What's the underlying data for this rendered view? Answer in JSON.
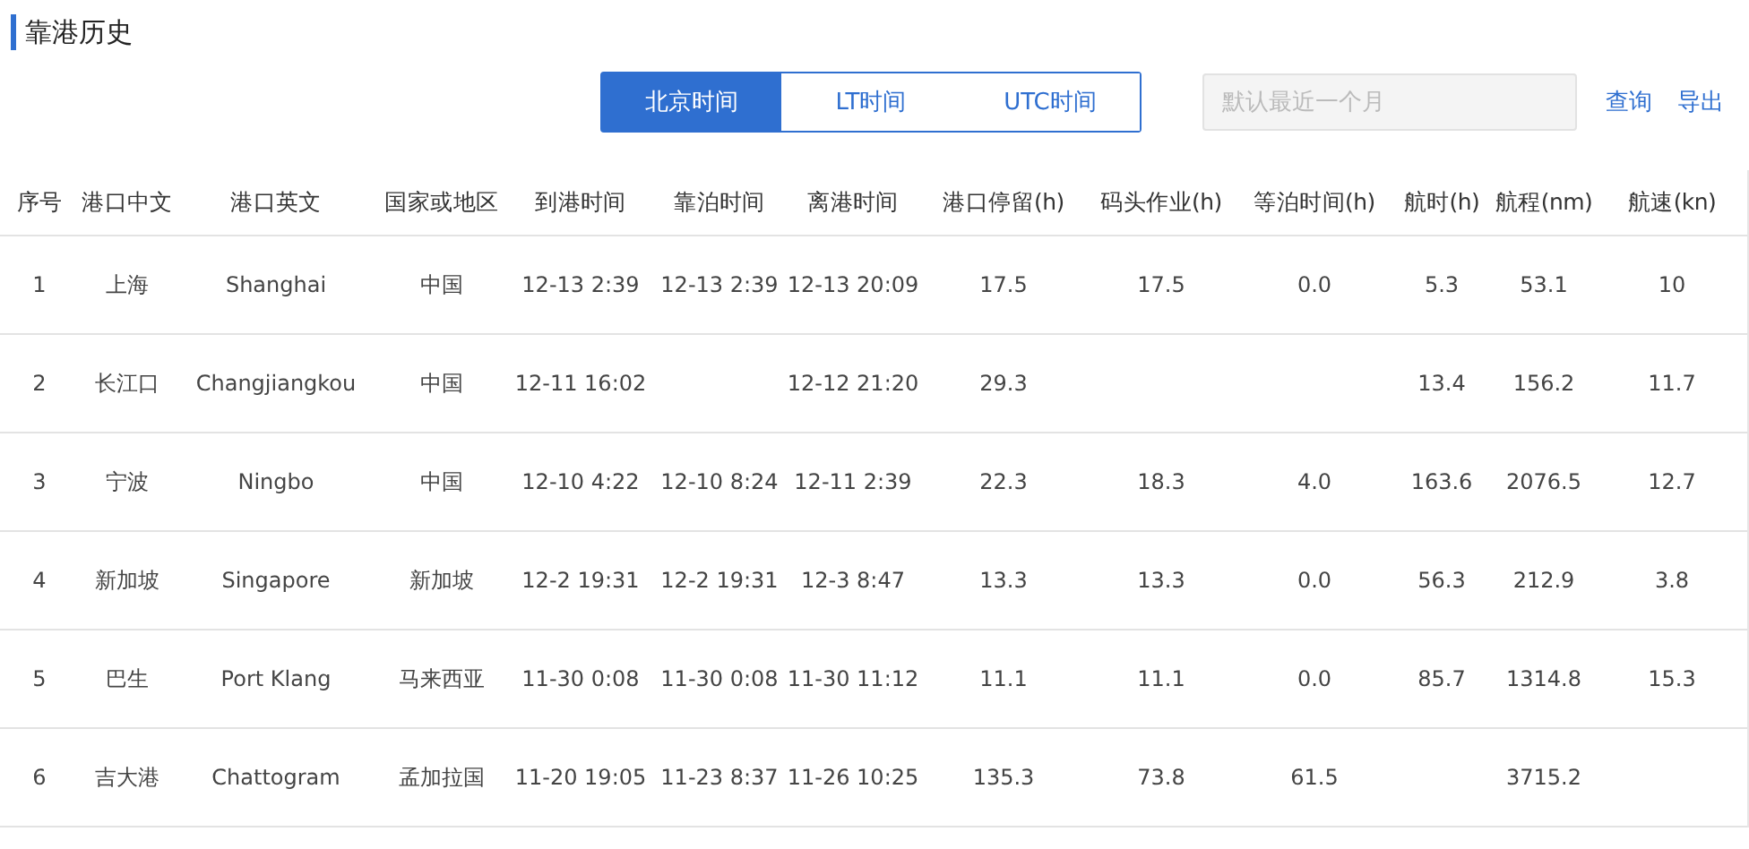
{
  "title": "靠港历史",
  "time_tabs": [
    {
      "label": "北京时间",
      "selected": true
    },
    {
      "label": "LT时间",
      "selected": false
    },
    {
      "label": "UTC时间",
      "selected": false
    }
  ],
  "date_field": {
    "placeholder": "默认最近一个月"
  },
  "actions": [
    "查询",
    "导出"
  ],
  "table": {
    "columns": [
      "序号",
      "港口中文",
      "港口英文",
      "国家或地区",
      "到港时间",
      "靠泊时间",
      "离港时间",
      "港口停留(h)",
      "码头作业(h)",
      "等泊时间(h)",
      "航时(h)",
      "航程(nm)",
      "航速(kn)"
    ],
    "rows": [
      {
        "cells": [
          "1",
          "上海",
          "Shanghai",
          "中国",
          "12-13 2:39",
          "12-13 2:39",
          "12-13 20:09",
          "17.5",
          "17.5",
          "0.0",
          "5.3",
          "53.1",
          "10"
        ]
      },
      {
        "cells": [
          "2",
          "长江口",
          "Changjiangkou",
          "中国",
          "12-11 16:02",
          null,
          "12-12 21:20",
          "29.3",
          null,
          null,
          "13.4",
          "156.2",
          "11.7"
        ]
      },
      {
        "cells": [
          "3",
          "宁波",
          "Ningbo",
          "中国",
          "12-10 4:22",
          "12-10 8:24",
          "12-11 2:39",
          "22.3",
          "18.3",
          "4.0",
          "163.6",
          "2076.5",
          "12.7"
        ]
      },
      {
        "cells": [
          "4",
          "新加坡",
          "Singapore",
          "新加坡",
          "12-2 19:31",
          "12-2 19:31",
          "12-3 8:47",
          "13.3",
          "13.3",
          "0.0",
          "56.3",
          "212.9",
          "3.8"
        ]
      },
      {
        "cells": [
          "5",
          "巴生",
          "Port Klang",
          "马来西亚",
          "11-30 0:08",
          "11-30 0:08",
          "11-30 11:12",
          "11.1",
          "11.1",
          "0.0",
          "85.7",
          "1314.8",
          "15.3"
        ]
      },
      {
        "cells": [
          "6",
          "吉大港",
          "Chattogram",
          "孟加拉国",
          "11-20 19:05",
          "11-23 8:37",
          "11-26 10:25",
          "135.3",
          "73.8",
          "61.5",
          null,
          "3715.2",
          null
        ]
      }
    ]
  }
}
